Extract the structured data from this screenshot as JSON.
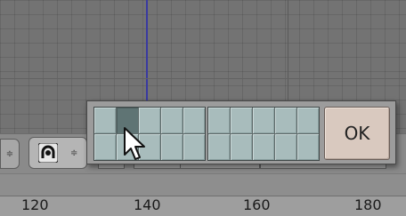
{
  "popup": {
    "ok_label": "OK",
    "left_grid_cells": 10,
    "right_grid_cells": 10,
    "active_cell": "left-grid row 1 col 2"
  },
  "header": {
    "mode_icon": "vertex-select-icon",
    "stepper_glyph": "≑",
    "mode_arrows_glyph": "≑"
  },
  "ruler": {
    "ticks": [
      "120",
      "140",
      "160",
      "180"
    ]
  },
  "colors": {
    "layer_cell": "#a8bcbc",
    "layer_cell_active": "#5f7474",
    "ok_button": "#d9c9bf",
    "axis_line": "#3a3aa0"
  }
}
